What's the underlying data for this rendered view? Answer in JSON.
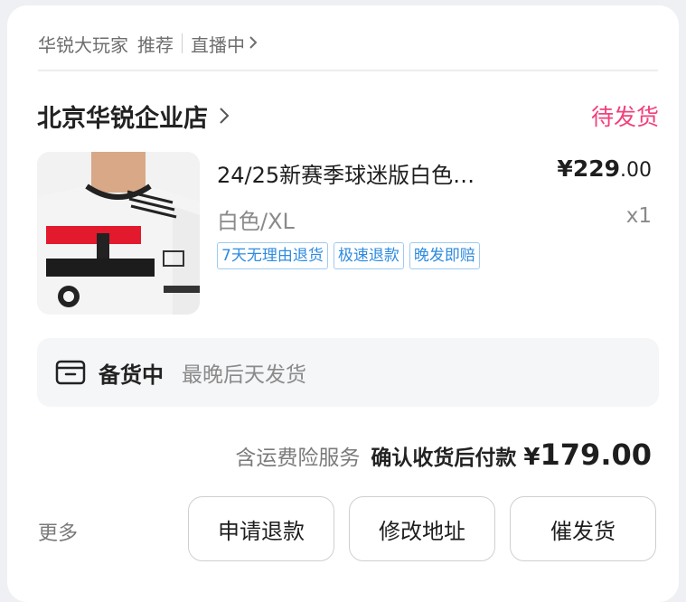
{
  "header": {
    "shop_nick": "华锐大玩家",
    "recommend": "推荐",
    "live": "直播中"
  },
  "order": {
    "shop_name": "北京华锐企业店",
    "status": "待发货",
    "product": {
      "title": "24/25新赛季球迷版白色…",
      "price_symbol": "¥",
      "price_int": "229",
      "price_dec": ".00",
      "variant": "白色/XL",
      "quantity": "x1",
      "tags": [
        "7天无理由退货",
        "极速退款",
        "晚发即赔"
      ],
      "image_icon": "jersey-image"
    },
    "prep": {
      "icon": "box-icon",
      "title": "备货中",
      "desc": "最晚后天发货"
    },
    "total": {
      "insurance": "含运费险服务",
      "pay_label": "确认收货后付款",
      "symbol": "¥",
      "amount": "179.00"
    }
  },
  "actions": {
    "more": "更多",
    "refund": "申请退款",
    "edit_address": "修改地址",
    "urge": "催发货"
  },
  "colors": {
    "status": "#f2407a",
    "tag": "#2f8be0"
  }
}
